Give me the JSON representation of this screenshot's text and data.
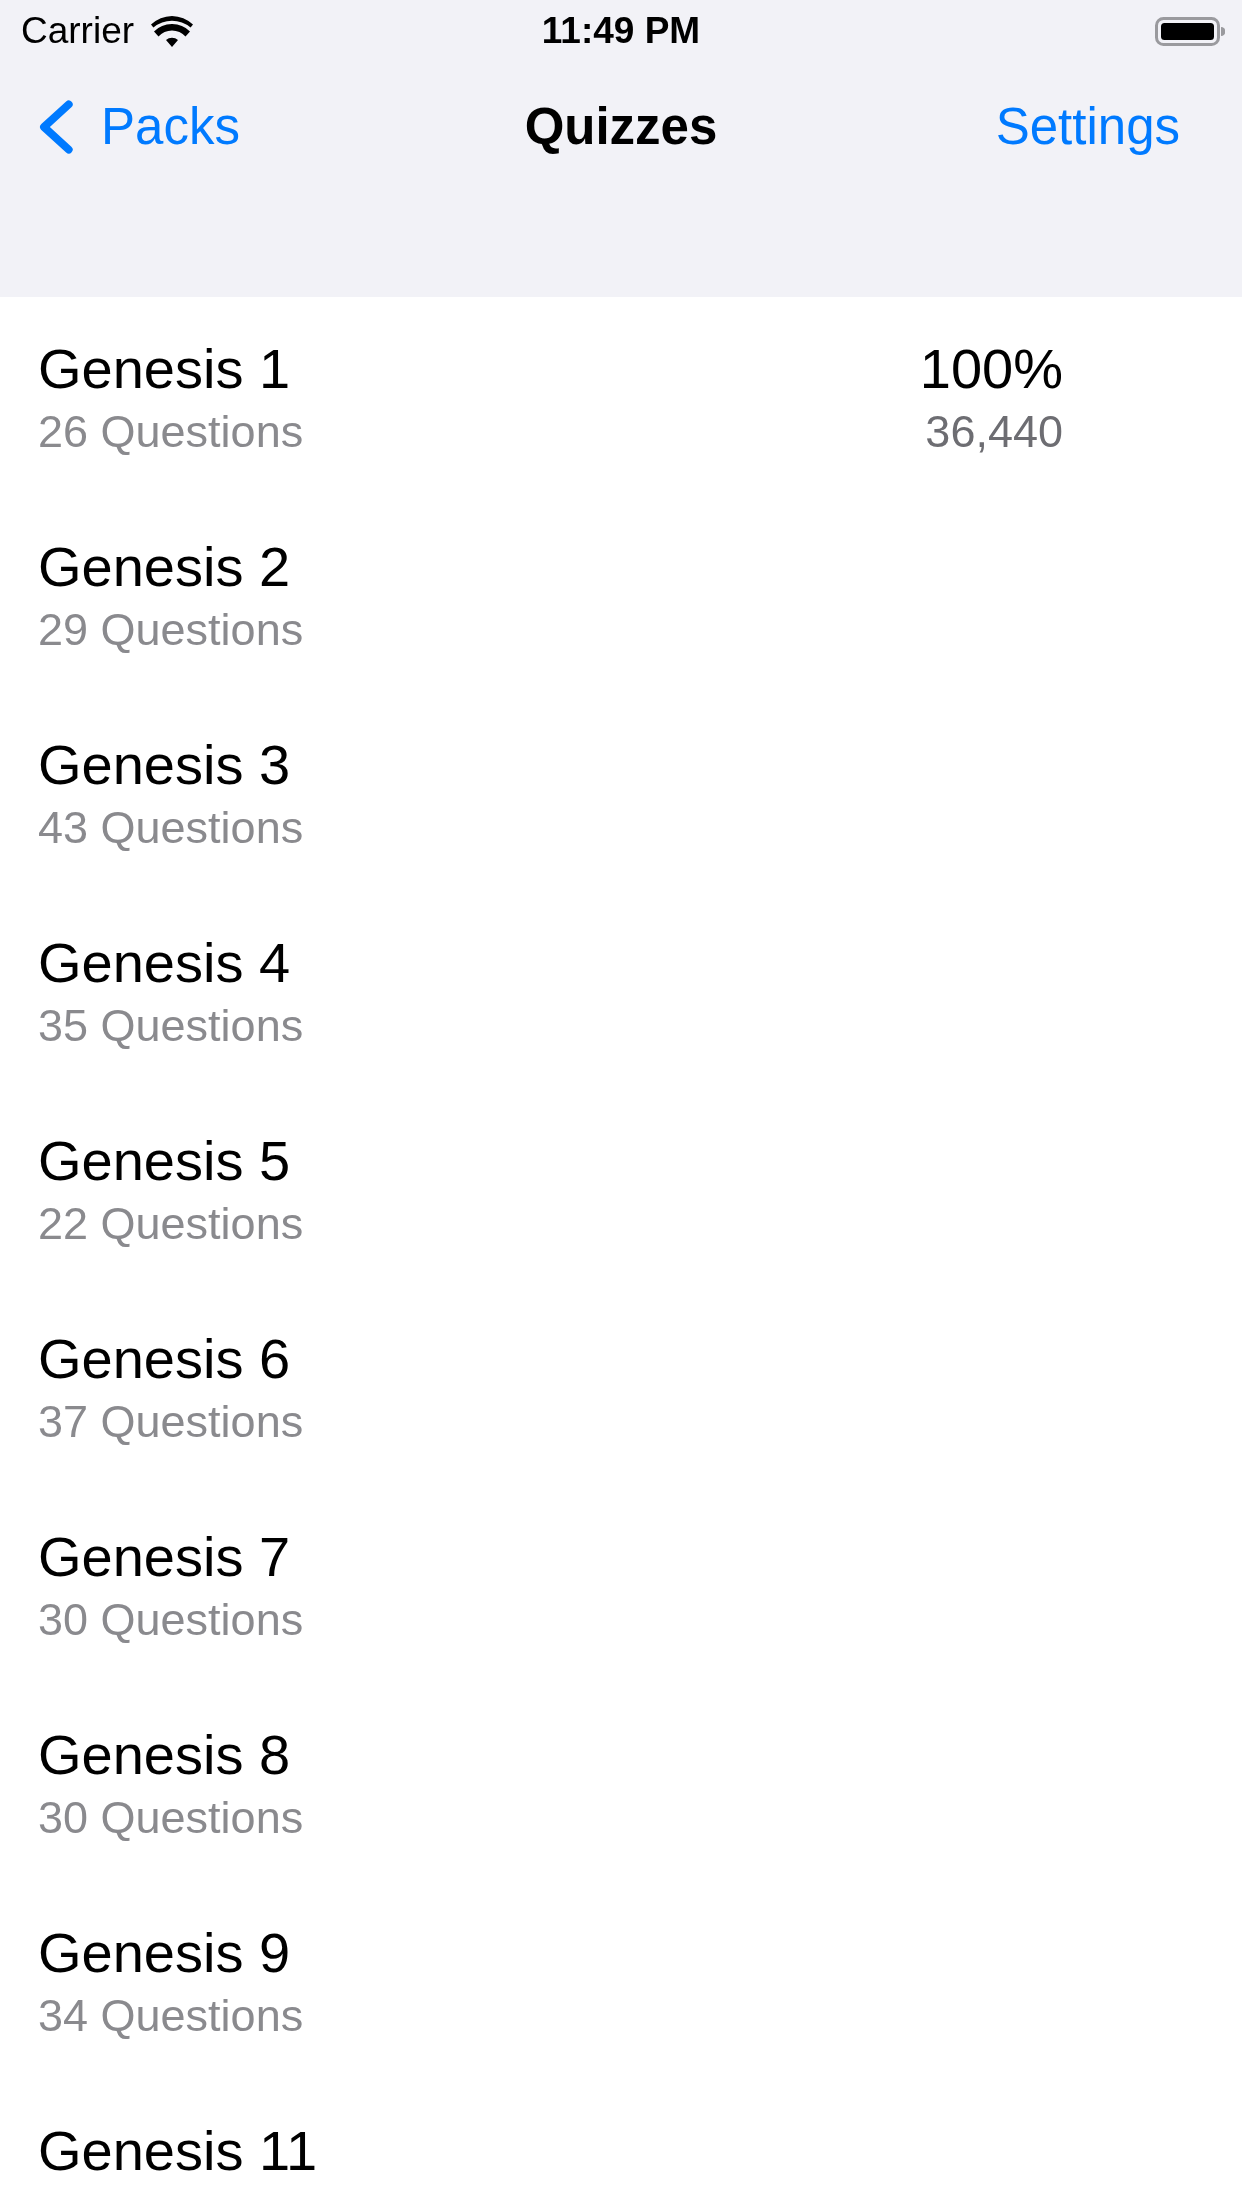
{
  "status_bar": {
    "carrier": "Carrier",
    "time": "11:49 PM"
  },
  "nav_bar": {
    "back": "Packs",
    "title": "Quizzes",
    "action": "Settings"
  },
  "quizzes": [
    {
      "title": "Genesis 1",
      "subtitle": "26 Questions",
      "percent": "100%",
      "points": "36,440"
    },
    {
      "title": "Genesis 2",
      "subtitle": "29 Questions"
    },
    {
      "title": "Genesis 3",
      "subtitle": "43 Questions"
    },
    {
      "title": "Genesis 4",
      "subtitle": "35 Questions"
    },
    {
      "title": "Genesis 5",
      "subtitle": "22 Questions"
    },
    {
      "title": "Genesis 6",
      "subtitle": "37 Questions"
    },
    {
      "title": "Genesis 7",
      "subtitle": "30 Questions"
    },
    {
      "title": "Genesis 8",
      "subtitle": "30 Questions"
    },
    {
      "title": "Genesis 9",
      "subtitle": "34 Questions"
    },
    {
      "title": "Genesis 11"
    }
  ]
}
